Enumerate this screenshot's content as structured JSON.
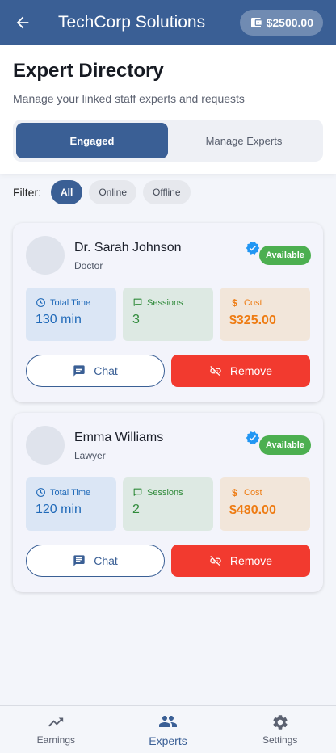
{
  "app": {
    "title": "TechCorp Solutions",
    "balance": "$2500.00"
  },
  "header": {
    "title": "Expert Directory",
    "subtitle": "Manage your linked staff experts and requests"
  },
  "tabs": [
    {
      "label": "Engaged",
      "active": true
    },
    {
      "label": "Manage Experts",
      "active": false
    }
  ],
  "filter": {
    "label": "Filter:",
    "options": [
      {
        "label": "All",
        "active": true
      },
      {
        "label": "Online",
        "active": false
      },
      {
        "label": "Offline",
        "active": false
      }
    ]
  },
  "experts": [
    {
      "name": "Dr. Sarah Johnson",
      "role": "Doctor",
      "status": "Available",
      "total_time_label": "Total Time",
      "total_time": "130 min",
      "sessions_label": "Sessions",
      "sessions": "3",
      "cost_label": "Cost",
      "cost": "$325.00",
      "chat_label": "Chat",
      "remove_label": "Remove"
    },
    {
      "name": "Emma Williams",
      "role": "Lawyer",
      "status": "Available",
      "total_time_label": "Total Time",
      "total_time": "120 min",
      "sessions_label": "Sessions",
      "sessions": "2",
      "cost_label": "Cost",
      "cost": "$480.00",
      "chat_label": "Chat",
      "remove_label": "Remove"
    }
  ],
  "bottom_nav": [
    {
      "label": "Earnings",
      "icon": "trending-up-icon",
      "active": false
    },
    {
      "label": "Experts",
      "icon": "people-icon",
      "active": true
    },
    {
      "label": "Settings",
      "icon": "gear-icon",
      "active": false
    }
  ],
  "colors": {
    "primary": "#3a5f95",
    "danger": "#f23a2f",
    "success": "#4caf50",
    "verified": "#2196f3"
  }
}
